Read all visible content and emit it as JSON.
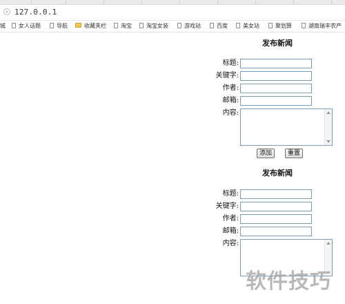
{
  "browser": {
    "url": "127.0.0.1",
    "bookmarks": [
      {
        "label": "城",
        "icon": "none"
      },
      {
        "label": "女人话题",
        "icon": "page-icon"
      },
      {
        "label": "导航",
        "icon": "page-icon"
      },
      {
        "label": "收藏夹栏",
        "icon": "folder-icon"
      },
      {
        "label": "淘宝",
        "icon": "page-icon"
      },
      {
        "label": "淘宝女装",
        "icon": "page-icon"
      },
      {
        "label": "游戏站",
        "icon": "page-icon"
      },
      {
        "label": "百度",
        "icon": "page-icon"
      },
      {
        "label": "美女站",
        "icon": "page-icon"
      },
      {
        "label": "聚划算",
        "icon": "page-icon"
      },
      {
        "label": "湖南瑞丰农产",
        "icon": "page-icon"
      }
    ]
  },
  "form1": {
    "title": "发布新闻",
    "labels": {
      "title": "标题:",
      "keywords": "关键字:",
      "author": "作者:",
      "email": "邮箱:",
      "content": "内容:"
    },
    "values": {
      "title": "",
      "keywords": "",
      "author": "",
      "email": "",
      "content": ""
    },
    "buttons": {
      "add": "添加",
      "reset": "重置"
    }
  },
  "form2": {
    "title": "发布新闻",
    "labels": {
      "title": "标题:",
      "keywords": "关键字:",
      "author": "作者:",
      "email": "邮箱:",
      "content": "内容:"
    }
  },
  "watermark": "软件技巧"
}
